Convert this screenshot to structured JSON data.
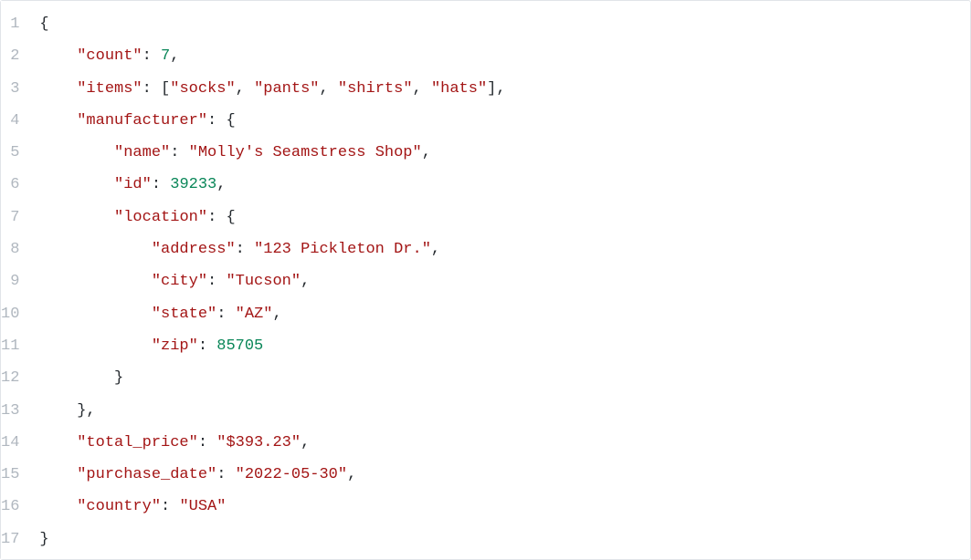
{
  "code": {
    "lines": [
      {
        "i": 1,
        "n": "1",
        "tokens": [
          {
            "t": "{",
            "c": "punct"
          }
        ]
      },
      {
        "i": 2,
        "n": "2",
        "tokens": [
          {
            "t": "    ",
            "c": ""
          },
          {
            "t": "\"count\"",
            "c": "key"
          },
          {
            "t": ": ",
            "c": "punct"
          },
          {
            "t": "7",
            "c": "num"
          },
          {
            "t": ",",
            "c": "punct"
          }
        ]
      },
      {
        "i": 3,
        "n": "3",
        "tokens": [
          {
            "t": "    ",
            "c": ""
          },
          {
            "t": "\"items\"",
            "c": "key"
          },
          {
            "t": ": [",
            "c": "punct"
          },
          {
            "t": "\"socks\"",
            "c": "str"
          },
          {
            "t": ", ",
            "c": "punct"
          },
          {
            "t": "\"pants\"",
            "c": "str"
          },
          {
            "t": ", ",
            "c": "punct"
          },
          {
            "t": "\"shirts\"",
            "c": "str"
          },
          {
            "t": ", ",
            "c": "punct"
          },
          {
            "t": "\"hats\"",
            "c": "str"
          },
          {
            "t": "],",
            "c": "punct"
          }
        ]
      },
      {
        "i": 4,
        "n": "4",
        "tokens": [
          {
            "t": "    ",
            "c": ""
          },
          {
            "t": "\"manufacturer\"",
            "c": "key"
          },
          {
            "t": ": {",
            "c": "punct"
          }
        ]
      },
      {
        "i": 5,
        "n": "5",
        "tokens": [
          {
            "t": "        ",
            "c": ""
          },
          {
            "t": "\"name\"",
            "c": "key"
          },
          {
            "t": ": ",
            "c": "punct"
          },
          {
            "t": "\"Molly's Seamstress Shop\"",
            "c": "str"
          },
          {
            "t": ",",
            "c": "punct"
          }
        ]
      },
      {
        "i": 6,
        "n": "6",
        "tokens": [
          {
            "t": "        ",
            "c": ""
          },
          {
            "t": "\"id\"",
            "c": "key"
          },
          {
            "t": ": ",
            "c": "punct"
          },
          {
            "t": "39233",
            "c": "num"
          },
          {
            "t": ",",
            "c": "punct"
          }
        ]
      },
      {
        "i": 7,
        "n": "7",
        "tokens": [
          {
            "t": "        ",
            "c": ""
          },
          {
            "t": "\"location\"",
            "c": "key"
          },
          {
            "t": ": {",
            "c": "punct"
          }
        ]
      },
      {
        "i": 8,
        "n": "8",
        "tokens": [
          {
            "t": "            ",
            "c": ""
          },
          {
            "t": "\"address\"",
            "c": "key"
          },
          {
            "t": ": ",
            "c": "punct"
          },
          {
            "t": "\"123 Pickleton Dr.\"",
            "c": "str"
          },
          {
            "t": ",",
            "c": "punct"
          }
        ]
      },
      {
        "i": 9,
        "n": "9",
        "tokens": [
          {
            "t": "            ",
            "c": ""
          },
          {
            "t": "\"city\"",
            "c": "key"
          },
          {
            "t": ": ",
            "c": "punct"
          },
          {
            "t": "\"Tucson\"",
            "c": "str"
          },
          {
            "t": ",",
            "c": "punct"
          }
        ]
      },
      {
        "i": 10,
        "n": "10",
        "tokens": [
          {
            "t": "            ",
            "c": ""
          },
          {
            "t": "\"state\"",
            "c": "key"
          },
          {
            "t": ": ",
            "c": "punct"
          },
          {
            "t": "\"AZ\"",
            "c": "str"
          },
          {
            "t": ",",
            "c": "punct"
          }
        ]
      },
      {
        "i": 11,
        "n": "11",
        "tokens": [
          {
            "t": "            ",
            "c": ""
          },
          {
            "t": "\"zip\"",
            "c": "key"
          },
          {
            "t": ": ",
            "c": "punct"
          },
          {
            "t": "85705",
            "c": "num"
          }
        ]
      },
      {
        "i": 12,
        "n": "12",
        "tokens": [
          {
            "t": "        }",
            "c": "punct"
          }
        ]
      },
      {
        "i": 13,
        "n": "13",
        "tokens": [
          {
            "t": "    },",
            "c": "punct"
          }
        ]
      },
      {
        "i": 14,
        "n": "14",
        "tokens": [
          {
            "t": "    ",
            "c": ""
          },
          {
            "t": "\"total_price\"",
            "c": "key"
          },
          {
            "t": ": ",
            "c": "punct"
          },
          {
            "t": "\"$393.23\"",
            "c": "str"
          },
          {
            "t": ",",
            "c": "punct"
          }
        ]
      },
      {
        "i": 15,
        "n": "15",
        "tokens": [
          {
            "t": "    ",
            "c": ""
          },
          {
            "t": "\"purchase_date\"",
            "c": "key"
          },
          {
            "t": ": ",
            "c": "punct"
          },
          {
            "t": "\"2022-05-30\"",
            "c": "str"
          },
          {
            "t": ",",
            "c": "punct"
          }
        ]
      },
      {
        "i": 16,
        "n": "16",
        "tokens": [
          {
            "t": "    ",
            "c": ""
          },
          {
            "t": "\"country\"",
            "c": "key"
          },
          {
            "t": ": ",
            "c": "punct"
          },
          {
            "t": "\"USA\"",
            "c": "str"
          }
        ]
      },
      {
        "i": 17,
        "n": "17",
        "tokens": [
          {
            "t": "}",
            "c": "punct"
          }
        ]
      }
    ]
  }
}
